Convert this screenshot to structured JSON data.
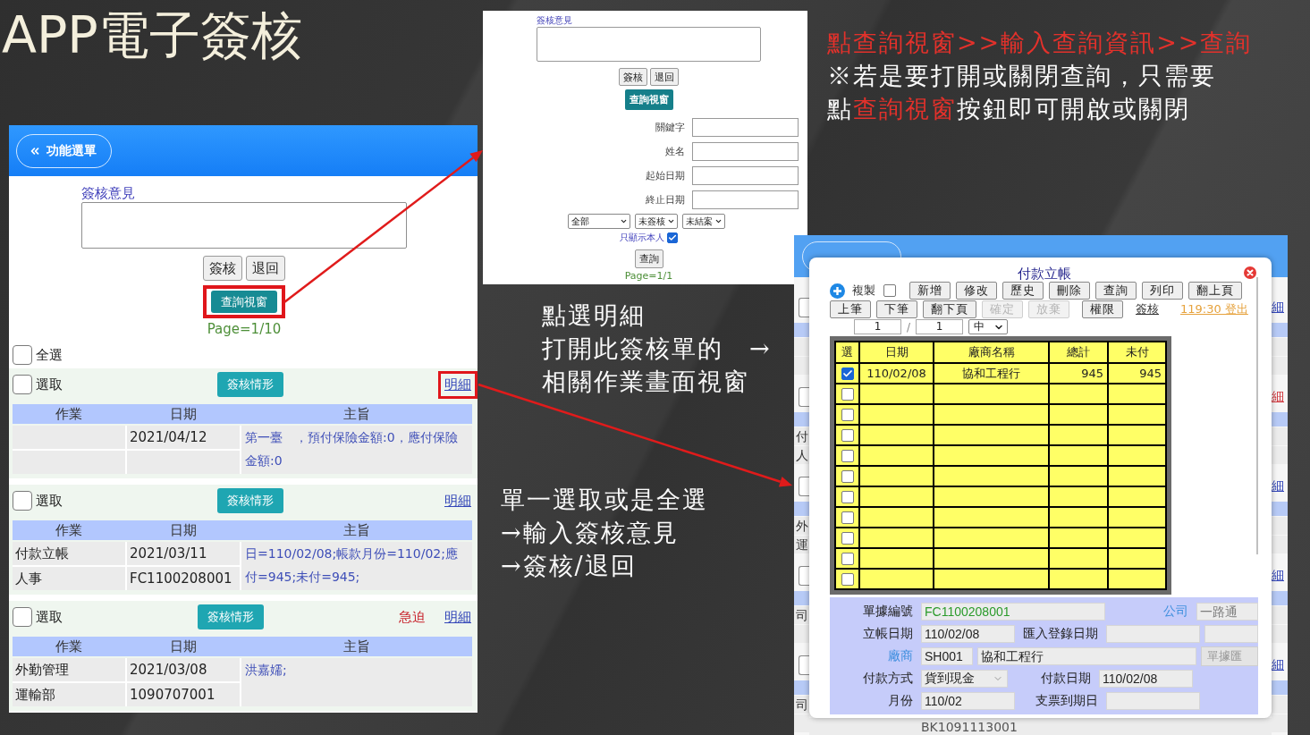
{
  "slide": {
    "title": "APP電子簽核"
  },
  "main_screen": {
    "menu_button": "功能選單",
    "opinion_label": "簽核意見",
    "action_buttons": [
      "簽核",
      "退回"
    ],
    "query_button": {
      "label": "查詢視窗",
      "highlighted": true
    },
    "page": "Page=1/10",
    "select_all": {
      "label": "全選",
      "checked": false
    },
    "records": [
      {
        "select_label": "選取",
        "checked": false,
        "status_button": "簽核情形",
        "detail_link": {
          "label": "明細",
          "highlighted": true
        },
        "columns": [
          "作業",
          "日期",
          "主旨"
        ],
        "date": "2021/04/12",
        "subject": "第一臺　，預付保險金額:0，應付保險金額:0"
      },
      {
        "select_label": "選取",
        "checked": false,
        "status_button": "簽核情形",
        "detail_link": {
          "label": "明細",
          "highlighted": false
        },
        "columns": [
          "作業",
          "日期",
          "主旨"
        ],
        "task": "付款立帳",
        "department": "人事",
        "date": "2021/03/11",
        "doc_no": "FC1100208001",
        "subject": "日=110/02/08;帳款月份=110/02;應付=945;未付=945;"
      },
      {
        "select_label": "選取",
        "checked": false,
        "status_button": "簽核情形",
        "urgent": "急迫",
        "detail_link": {
          "label": "明細",
          "highlighted": false
        },
        "columns": [
          "作業",
          "日期",
          "主旨"
        ],
        "task": "外勤管理",
        "department": "運輸部",
        "date": "2021/03/08",
        "doc_no": "1090707001",
        "subject": "洪嘉嬬;"
      }
    ]
  },
  "query_screen": {
    "opinion_label": "簽核意見",
    "action_buttons": [
      "簽核",
      "退回"
    ],
    "query_button": "查詢視窗",
    "fields": [
      {
        "label": "關鍵字"
      },
      {
        "label": "姓名"
      },
      {
        "label": "起始日期"
      },
      {
        "label": "終止日期"
      }
    ],
    "filters": [
      "全部",
      "未簽核",
      "未結案"
    ],
    "only_me": {
      "label": "只顯示本人",
      "checked": true
    },
    "search_button": "查詢",
    "page": "Page=1/1"
  },
  "query_note": {
    "lines": [
      [
        {
          "text": "點查詢視窗>>輸入查詢資訊>>查詢",
          "highlight": true
        }
      ],
      [
        {
          "text": "※若是要打開或關閉查詢，只需要",
          "highlight": false
        }
      ],
      [
        {
          "text": "點",
          "highlight": false
        },
        {
          "text": "查詢視窗",
          "highlight": true
        },
        {
          "text": "按鈕即可開啟或關閉",
          "highlight": false
        }
      ]
    ]
  },
  "detail_note": {
    "lines": [
      "點選明細",
      "打開此簽核單的　→",
      "相關作業畫面視窗"
    ]
  },
  "select_note": {
    "lines": [
      "單一選取或是全選",
      "→輸入簽核意見",
      "→簽核/退回"
    ]
  },
  "payment_app": {
    "background": {
      "records": [
        {
          "checked": false,
          "detail_link": {
            "label": "細",
            "color": "#3346b8"
          }
        },
        {
          "checked": false,
          "detail_link": {
            "label": "細",
            "color": "#d0343a"
          },
          "cells": [
            "付",
            "人"
          ]
        },
        {
          "checked": false,
          "detail_link": {
            "label": "細",
            "color": "#3346b8"
          },
          "cells": [
            "外",
            "運"
          ]
        },
        {
          "checked": false,
          "detail_link": {
            "label": "細",
            "color": "#3346b8"
          },
          "cells": [
            "司"
          ]
        },
        {
          "checked": false,
          "detail_link": {
            "label": "細",
            "color": "#3346b8"
          },
          "cells": [
            "司"
          ]
        }
      ],
      "bottom_text": "BK1091113001"
    },
    "dialog": {
      "title": "付款立帳",
      "copy": {
        "label": "複製",
        "checked": false
      },
      "toolbar": [
        {
          "label": "新增",
          "disabled": false
        },
        {
          "label": "修改",
          "disabled": false
        },
        {
          "label": "歷史",
          "disabled": false
        },
        {
          "label": "刪除",
          "disabled": false
        },
        {
          "label": "查詢",
          "disabled": false
        },
        {
          "label": "列印",
          "disabled": false
        },
        {
          "label": "翻上頁",
          "disabled": false
        }
      ],
      "toolbar_2": [
        {
          "label": "上筆",
          "disabled": false
        },
        {
          "label": "下筆",
          "disabled": false
        },
        {
          "label": "翻下頁",
          "disabled": false
        },
        {
          "label": "確定",
          "disabled": true
        },
        {
          "label": "放棄",
          "disabled": true
        },
        {
          "label": "權限",
          "disabled": false
        }
      ],
      "sign_link": "簽核",
      "logout_link": "119:30 登出",
      "page_current": "1",
      "page_separator": "/",
      "page_total": "1",
      "size_select": "中",
      "columns": [
        "選",
        "日期",
        "廠商名稱",
        "總計",
        "未付"
      ],
      "rows": [
        {
          "checked": true,
          "date": "110/02/08",
          "vendor": "協和工程行",
          "total": "945",
          "unpaid": "945"
        },
        {
          "checked": false
        },
        {
          "checked": false
        },
        {
          "checked": false
        },
        {
          "checked": false
        },
        {
          "checked": false
        },
        {
          "checked": false
        },
        {
          "checked": false
        },
        {
          "checked": false
        },
        {
          "checked": false
        },
        {
          "checked": false
        }
      ],
      "form": [
        [
          {
            "kind": "label",
            "text": "單據編號"
          },
          {
            "kind": "code_field",
            "value": "FC1100208001"
          },
          {
            "kind": "link_label",
            "text": "公司"
          },
          {
            "kind": "tail_field",
            "value": "一路通"
          }
        ],
        [
          {
            "kind": "label",
            "text": "立帳日期"
          },
          {
            "kind": "field",
            "value": "110/02/08"
          },
          {
            "kind": "label",
            "text": "匯入登錄日期"
          },
          {
            "kind": "field"
          },
          {
            "kind": "tail_field"
          }
        ],
        [
          {
            "kind": "link_label",
            "text": "廠商"
          },
          {
            "kind": "short_field",
            "value": "SH001"
          },
          {
            "kind": "name_field",
            "value": "協和工程行"
          },
          {
            "kind": "button",
            "text": "單據匯"
          }
        ],
        [
          {
            "kind": "label",
            "text": "付款方式"
          },
          {
            "kind": "select",
            "value": "貨到現金"
          },
          {
            "kind": "label",
            "text": "付款日期"
          },
          {
            "kind": "field",
            "value": "110/02/08"
          }
        ],
        [
          {
            "kind": "label",
            "text": "月份"
          },
          {
            "kind": "field",
            "value": "110/02"
          },
          {
            "kind": "label",
            "text": "支票到期日"
          },
          {
            "kind": "field"
          }
        ]
      ]
    }
  }
}
